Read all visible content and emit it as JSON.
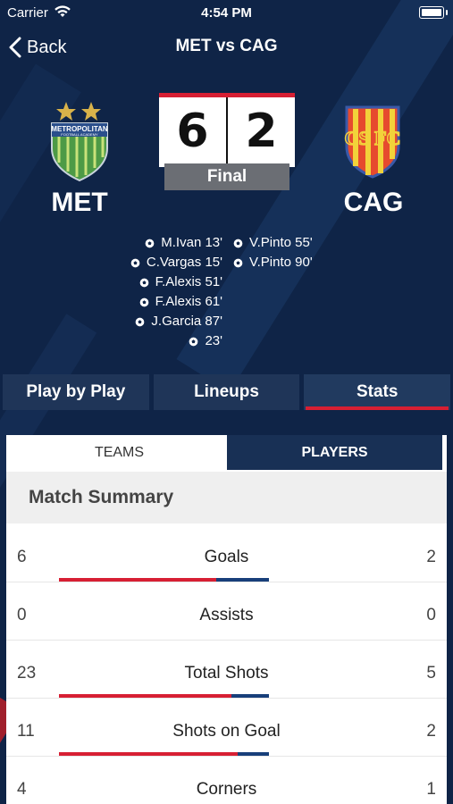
{
  "status_bar": {
    "carrier": "Carrier",
    "time": "4:54 PM"
  },
  "nav": {
    "back_label": "Back",
    "title": "MET vs CAG"
  },
  "match": {
    "home": {
      "abbr": "MET",
      "score": "6",
      "crest_text": "METROPOLITAN",
      "crest_subtext": "FOOTBALL ACADEMY"
    },
    "away": {
      "abbr": "CAG",
      "score": "2",
      "crest_text": "CS FC"
    },
    "status": "Final"
  },
  "scorers": {
    "home": [
      "M.Ivan 13'",
      "C.Vargas 15'",
      "F.Alexis 51'",
      "F.Alexis 61'",
      "J.Garcia 87'",
      "23'"
    ],
    "away": [
      "V.Pinto 55'",
      "V.Pinto 90'"
    ]
  },
  "tabs": [
    "Play by Play",
    "Lineups",
    "Stats"
  ],
  "active_tab": "Stats",
  "subtabs": [
    "TEAMS",
    "PLAYERS"
  ],
  "active_subtab": "TEAMS",
  "summary_title": "Match Summary",
  "stats": [
    {
      "label": "Goals",
      "home": "6",
      "away": "2",
      "home_share": 0.75
    },
    {
      "label": "Assists",
      "home": "0",
      "away": "0",
      "home_share": null
    },
    {
      "label": "Total Shots",
      "home": "23",
      "away": "5",
      "home_share": 0.82
    },
    {
      "label": "Shots on Goal",
      "home": "11",
      "away": "2",
      "home_share": 0.85
    },
    {
      "label": "Corners",
      "home": "4",
      "away": "1",
      "home_share": 0.8
    }
  ],
  "colors": {
    "background": "#0f2447",
    "accent_red": "#d71f33",
    "navy": "#183055",
    "final_gray": "#6b6e74"
  }
}
